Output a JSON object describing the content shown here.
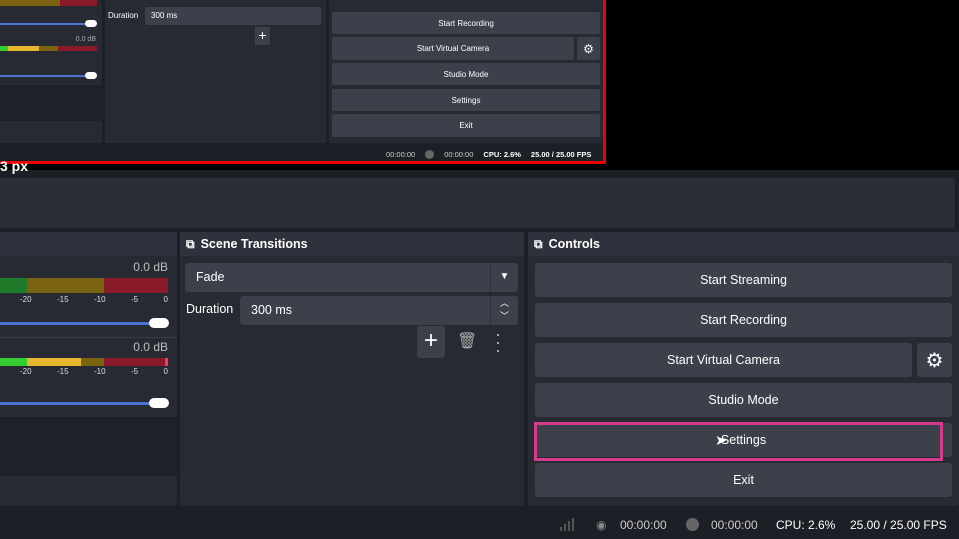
{
  "preview": {
    "size_label": "3 px",
    "duration_label": "Duration",
    "duration_value": "300 ms",
    "db1": "0.0 dB",
    "buttons": [
      "Start Recording",
      "Start Virtual Camera",
      "Studio Mode",
      "Settings",
      "Exit"
    ],
    "status": {
      "stream_time": "00:00:00",
      "rec_time": "00:00:00",
      "cpu": "CPU: 2.6%",
      "fps": "25.00 / 25.00 FPS"
    }
  },
  "audio": {
    "tracks": [
      {
        "db": "0.0 dB"
      },
      {
        "db": "0.0 dB"
      }
    ],
    "ticks": [
      "-20",
      "-15",
      "-10",
      "-5",
      "0"
    ]
  },
  "transitions": {
    "title": "Scene Transitions",
    "selected": "Fade",
    "duration_label": "Duration",
    "duration_value": "300 ms"
  },
  "controls": {
    "title": "Controls",
    "start_streaming": "Start Streaming",
    "start_recording": "Start Recording",
    "start_virtual_camera": "Start Virtual Camera",
    "studio_mode": "Studio Mode",
    "settings": "Settings",
    "exit": "Exit",
    "highlight_color": "#d63a8c"
  },
  "status": {
    "stream_time": "00:00:00",
    "rec_time": "00:00:00",
    "cpu": "CPU: 2.6%",
    "fps": "25.00 / 25.00 FPS"
  }
}
